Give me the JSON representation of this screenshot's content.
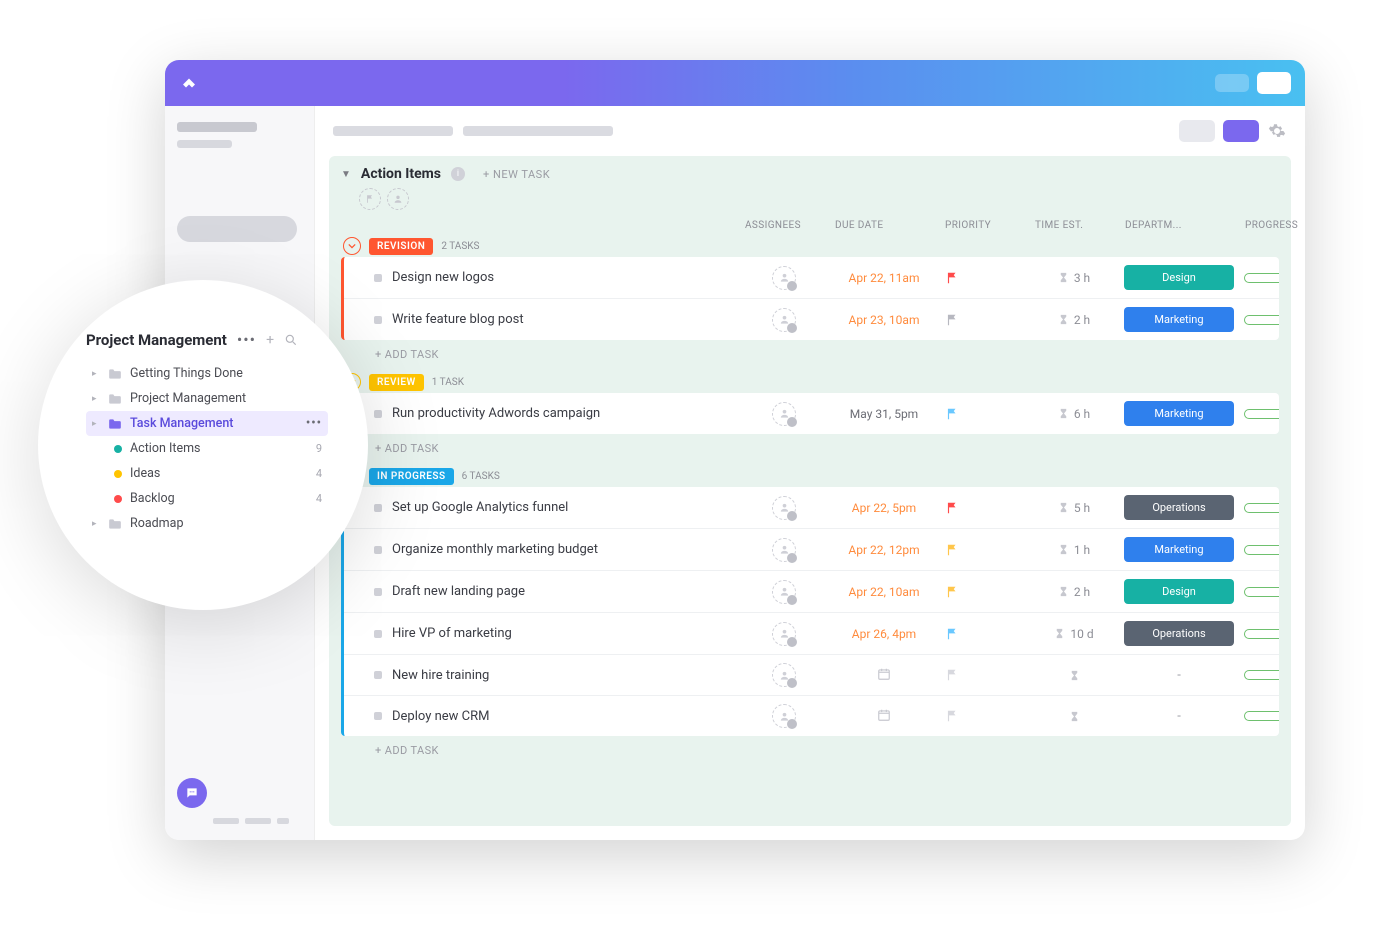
{
  "section": {
    "title": "Action Items",
    "new_task": "+ NEW TASK"
  },
  "columns": {
    "assignees": "ASSIGNEES",
    "due": "DUE DATE",
    "priority": "PRIORITY",
    "est": "TIME EST.",
    "dept": "DEPARTM...",
    "progress": "PROGRESS"
  },
  "add_task": "+ ADD TASK",
  "groups": [
    {
      "label": "REVISION",
      "color": "#ff5630",
      "count": "2 TASKS",
      "tasks": [
        {
          "name": "Design new logos",
          "due": "Apr 22, 11am",
          "due_color": "orange",
          "flag": "#ff4b4b",
          "est": "3 h",
          "dept": "Design",
          "dept_color": "#17b1a4",
          "progress": "0%"
        },
        {
          "name": "Write feature blog post",
          "due": "Apr 23, 10am",
          "due_color": "orange",
          "flag": "#b7b8c0",
          "est": "2 h",
          "dept": "Marketing",
          "dept_color": "#2f80ed",
          "progress": "0%"
        }
      ]
    },
    {
      "label": "REVIEW",
      "color": "#ffc400",
      "count": "1 TASK",
      "tasks": [
        {
          "name": "Run productivity Adwords campaign",
          "due": "May 31, 5pm",
          "due_color": "gray",
          "flag": "#6ac8ff",
          "est": "6 h",
          "dept": "Marketing",
          "dept_color": "#2f80ed",
          "progress": "0%"
        }
      ]
    },
    {
      "label": "IN PROGRESS",
      "color": "#1aa7e8",
      "count": "6 TASKS",
      "tasks": [
        {
          "name": "Set up Google Analytics funnel",
          "due": "Apr 22, 5pm",
          "due_color": "orange",
          "flag": "#ff4b4b",
          "est": "5 h",
          "dept": "Operations",
          "dept_color": "#5a6472",
          "progress": "0%"
        },
        {
          "name": "Organize monthly marketing budget",
          "due": "Apr 22, 12pm",
          "due_color": "orange",
          "flag": "#ffc64b",
          "est": "1 h",
          "dept": "Marketing",
          "dept_color": "#2f80ed",
          "progress": "0%"
        },
        {
          "name": "Draft new landing page",
          "due": "Apr 22, 10am",
          "due_color": "orange",
          "flag": "#ffc64b",
          "est": "2 h",
          "dept": "Design",
          "dept_color": "#17b1a4",
          "progress": "0%"
        },
        {
          "name": "Hire VP of marketing",
          "due": "Apr 26, 4pm",
          "due_color": "orange",
          "flag": "#6ac8ff",
          "est": "10 d",
          "dept": "Operations",
          "dept_color": "#5a6472",
          "progress": "0%"
        },
        {
          "name": "New hire training",
          "due": "",
          "due_color": "",
          "flag": "",
          "est": "",
          "dept": "-",
          "dept_color": "",
          "progress": "0%"
        },
        {
          "name": "Deploy new CRM",
          "due": "",
          "due_color": "",
          "flag": "",
          "est": "",
          "dept": "-",
          "dept_color": "",
          "progress": "0%"
        }
      ]
    }
  ],
  "nav": {
    "title": "Project Management",
    "items": [
      {
        "label": "Getting Things Done",
        "type": "folder"
      },
      {
        "label": "Project Management",
        "type": "folder"
      },
      {
        "label": "Task Management",
        "type": "folder",
        "selected": true
      },
      {
        "label": "Roadmap",
        "type": "folder"
      }
    ],
    "sub": [
      {
        "label": "Action Items",
        "dot": "#17b1a4",
        "count": "9"
      },
      {
        "label": "Ideas",
        "dot": "#ffc400",
        "count": "4"
      },
      {
        "label": "Backlog",
        "dot": "#ff4b4b",
        "count": "4"
      }
    ]
  }
}
